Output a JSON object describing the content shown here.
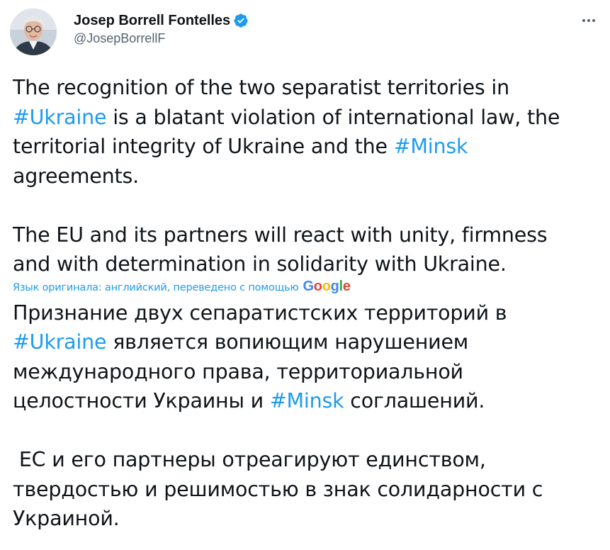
{
  "author": {
    "display_name": "Josep Borrell Fontelles",
    "handle": "@JosepBorrellF",
    "verified": true
  },
  "tweet": {
    "original": {
      "p1": {
        "l1": "The recognition of the two separatist territories in",
        "l2_tag": "#Ukraine",
        "l2_rest": " is a blatant violation of international law, the",
        "l3_pre": "territorial integrity of Ukraine and the ",
        "l3_tag": "#Minsk",
        "l4": "agreements."
      },
      "p2": {
        "l1": "The EU and its partners will react with unity, firmness",
        "l2": "and with determination in solidarity with Ukraine."
      }
    },
    "translation_note": "Язык оригинала: английский, переведено с помощью",
    "translation_provider": {
      "G": "G",
      "o1": "o",
      "o2": "o",
      "g": "g",
      "l": "l",
      "e": "e"
    },
    "translated": {
      "p1": {
        "l1": "Признание двух сепаратистских территорий в",
        "l2_tag": "#Ukraine",
        "l2_rest": " является вопиющим нарушением",
        "l3": "международного права, территориальной",
        "l4_pre": "целостности Украины и ",
        "l4_tag": "#Minsk",
        "l4_rest": " соглашений."
      },
      "p2": {
        "l1": " ЕС и его партнеры отреагируют единством,",
        "l2": "твердостью и решимостью в знак солидарности с",
        "l3": "Украиной."
      }
    }
  },
  "colors": {
    "link": "#1d9bf0",
    "text": "#0f1419",
    "secondary": "#536471",
    "verified_badge": "#1d9bf0"
  },
  "icons": {
    "verified": "verified-badge-icon",
    "more": "more-options-icon",
    "avatar": "avatar-photo"
  }
}
